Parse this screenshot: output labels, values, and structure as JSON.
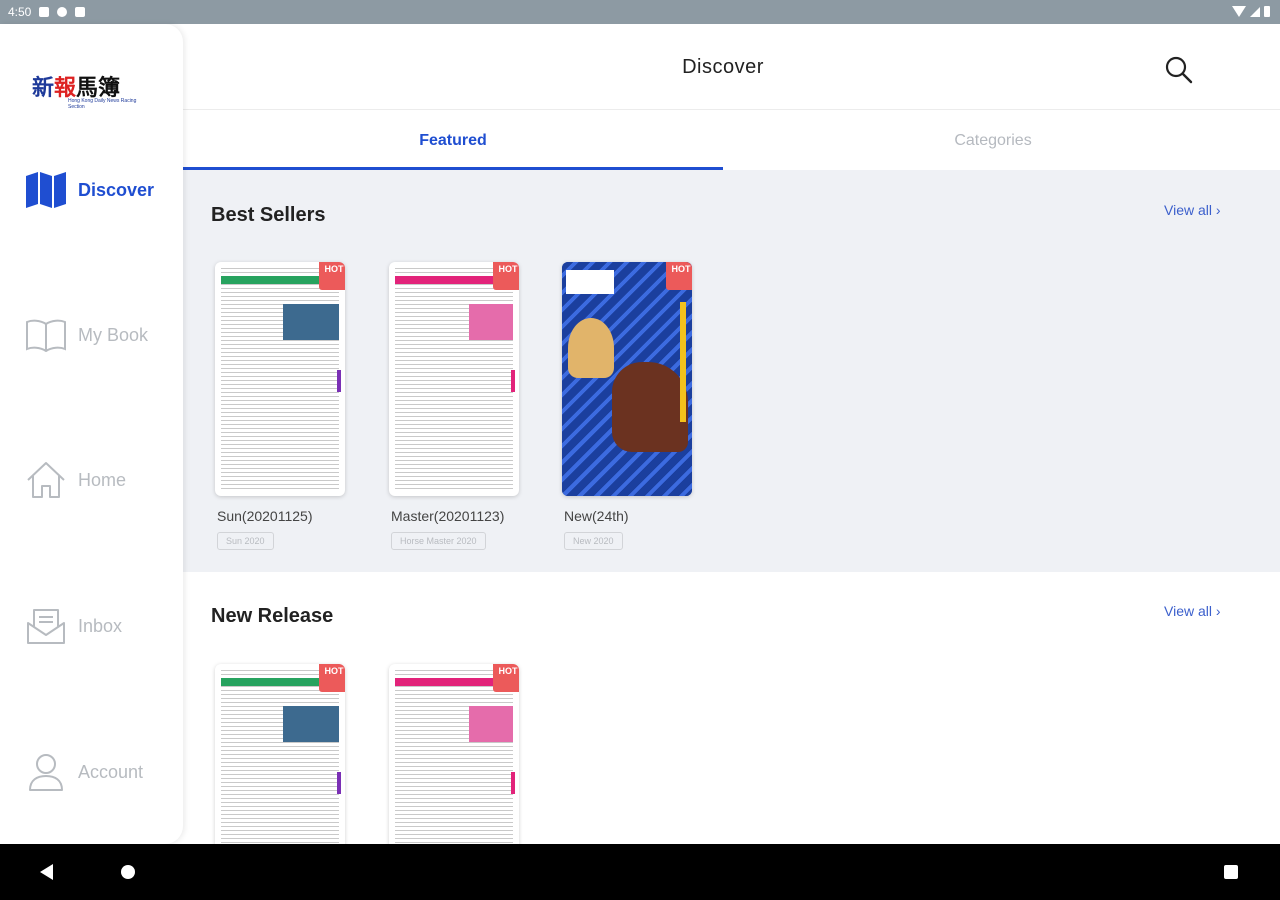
{
  "status_bar": {
    "time": "4:50"
  },
  "sidebar": {
    "logo": {
      "chars": [
        "新",
        "報",
        "馬簿"
      ],
      "subtitle": "Hong Kong Daily News Racing Section"
    },
    "items": [
      {
        "label": "Discover",
        "icon": "map-icon",
        "active": true
      },
      {
        "label": "My Book",
        "icon": "open-book-icon",
        "active": false
      },
      {
        "label": "Home",
        "icon": "house-icon",
        "active": false
      },
      {
        "label": "Inbox",
        "icon": "inbox-icon",
        "active": false
      },
      {
        "label": "Account",
        "icon": "user-icon",
        "active": false
      }
    ]
  },
  "header": {
    "title": "Discover",
    "search_icon": "search-icon"
  },
  "tabs": [
    {
      "label": "Featured",
      "active": true
    },
    {
      "label": "Categories",
      "active": false
    }
  ],
  "best_sellers": {
    "title": "Best Sellers",
    "view_all": "View all ›",
    "books": [
      {
        "title": "Sun(20201125)",
        "tag": "Sun 2020",
        "badge": "HOT"
      },
      {
        "title": "Master(20201123)",
        "tag": "Horse Master 2020",
        "badge": "HOT"
      },
      {
        "title": "New(24th)",
        "tag": "New 2020",
        "badge": "HOT"
      }
    ]
  },
  "new_release": {
    "title": "New Release",
    "view_all": "View all ›",
    "books": [
      {
        "badge": "HOT"
      },
      {
        "badge": "HOT"
      }
    ]
  },
  "colors": {
    "accent": "#1f4ed1",
    "section_bg": "#eff1f5",
    "hot_badge": "#ec5a5a",
    "status_bar": "#8d9aa3"
  }
}
